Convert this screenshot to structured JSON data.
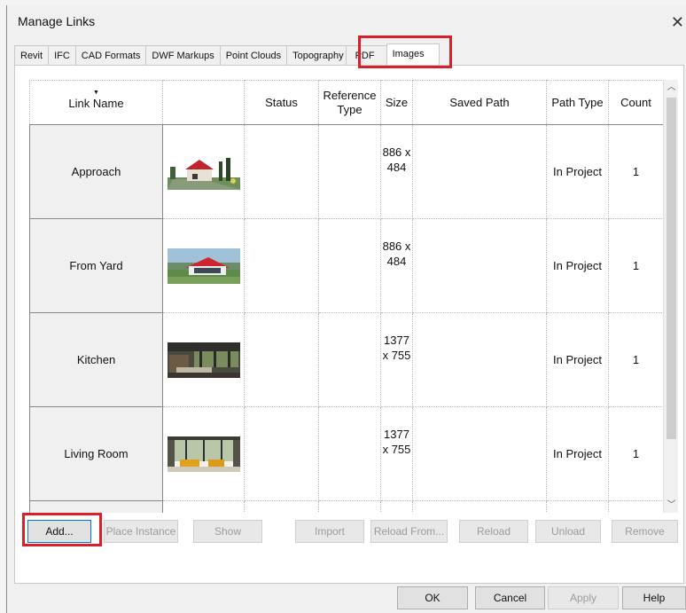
{
  "dialog": {
    "title": "Manage Links"
  },
  "tabs": [
    "Revit",
    "IFC",
    "CAD Formats",
    "DWF Markups",
    "Point Clouds",
    "Topography",
    "PDF",
    "Images"
  ],
  "active_tab": "Images",
  "table": {
    "headers": {
      "link_name": "Link Name",
      "thumbnail": "",
      "status": "Status",
      "reference_type": "Reference Type",
      "size": "Size",
      "saved_path": "Saved Path",
      "path_type": "Path Type",
      "count": "Count"
    },
    "rows": [
      {
        "name": "Approach",
        "status": "",
        "reference_type": "",
        "size_line1": "886 x",
        "size_line2": "484",
        "saved_path": "",
        "path_type": "In Project",
        "count": "1"
      },
      {
        "name": "From Yard",
        "status": "",
        "reference_type": "",
        "size_line1": "886 x",
        "size_line2": "484",
        "saved_path": "",
        "path_type": "In Project",
        "count": "1"
      },
      {
        "name": "Kitchen",
        "status": "",
        "reference_type": "",
        "size_line1": "1377",
        "size_line2": "x 755",
        "saved_path": "",
        "path_type": "In Project",
        "count": "1"
      },
      {
        "name": "Living Room",
        "status": "",
        "reference_type": "",
        "size_line1": "1377",
        "size_line2": "x 755",
        "saved_path": "",
        "path_type": "In Project",
        "count": "1"
      }
    ]
  },
  "actions": {
    "add": "Add...",
    "place_instance": "Place Instance",
    "show": "Show",
    "import": "Import",
    "reload_from": "Reload From...",
    "reload": "Reload",
    "unload": "Unload",
    "remove": "Remove"
  },
  "footer": {
    "ok": "OK",
    "cancel": "Cancel",
    "apply": "Apply",
    "help": "Help"
  },
  "icons": {
    "close": "close-icon",
    "scroll_up": "chevron-up-icon",
    "scroll_down": "chevron-down-icon",
    "sort": "sort-indicator-icon"
  },
  "colors": {
    "highlight": "#d9202a",
    "header_bg": "#ffffff",
    "dialog_bg": "#f0f0f0"
  }
}
